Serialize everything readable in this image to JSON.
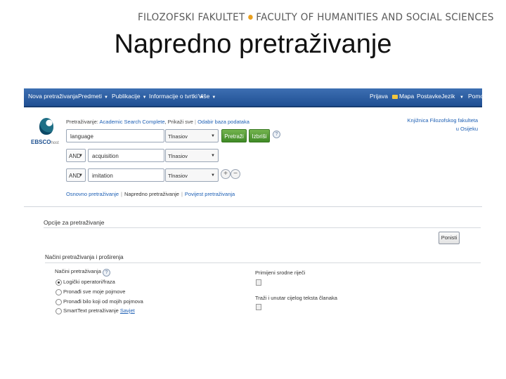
{
  "banner": {
    "left": "FILOZOFSKI FAKULTET",
    "right": "FACULTY OF HUMANITIES AND SOCIAL SCIENCES"
  },
  "slide_title": "Napredno pretraživanje",
  "topnav": {
    "items": [
      "Nova pretraživanja",
      "Predmeti",
      "Publikacije",
      "Informacije o tvrtki",
      "Više"
    ],
    "right": [
      "Prijava",
      "Mapa",
      "Postavke",
      "Jezik",
      "Pomoć"
    ]
  },
  "logo": {
    "brand": "EBSCO",
    "suffix": "host"
  },
  "searching": {
    "prefix": "Pretraživanje:",
    "database": "Academic Search Complete",
    "suffix": "Prikaži sve",
    "choose": "Odabir baza podataka"
  },
  "partner": {
    "line1": "Knjižnica Filozofskog fakulteta",
    "line2": "u Osijeku"
  },
  "rows": [
    {
      "op": "",
      "term": "language",
      "field": "Tlnasiov"
    },
    {
      "op": "AND",
      "term": "acquisition",
      "field": "Tlnasiov"
    },
    {
      "op": "AND",
      "term": "imitation",
      "field": "Tlnasiov"
    }
  ],
  "buttons": {
    "search": "Pretraži",
    "clear": "Izbriši",
    "help": "?",
    "add": "+",
    "remove": "−"
  },
  "links": [
    "Osnovno pretraživanje",
    "Napredno pretraživanje",
    "Povijest pretraživanja"
  ],
  "options": {
    "title": "Opcije za pretraživanje",
    "reset": "Ponisti",
    "modes_title": "Načini pretraživanja i proširenja",
    "modes_label": "Načini pretraživanja",
    "modes": [
      {
        "text": "Logički operatori/fraza",
        "selected": true
      },
      {
        "text": "Pronađi sve moje pojmove",
        "selected": false
      },
      {
        "text": "Pronađi bilo koji od mojih pojmova",
        "selected": false
      },
      {
        "text": "SmartText pretraživanje",
        "selected": false,
        "hint": "Savjet"
      }
    ],
    "apply_related": "Primijeni srodne riječi",
    "fulltext": "Traži i unutar cijelog teksta članaka"
  }
}
